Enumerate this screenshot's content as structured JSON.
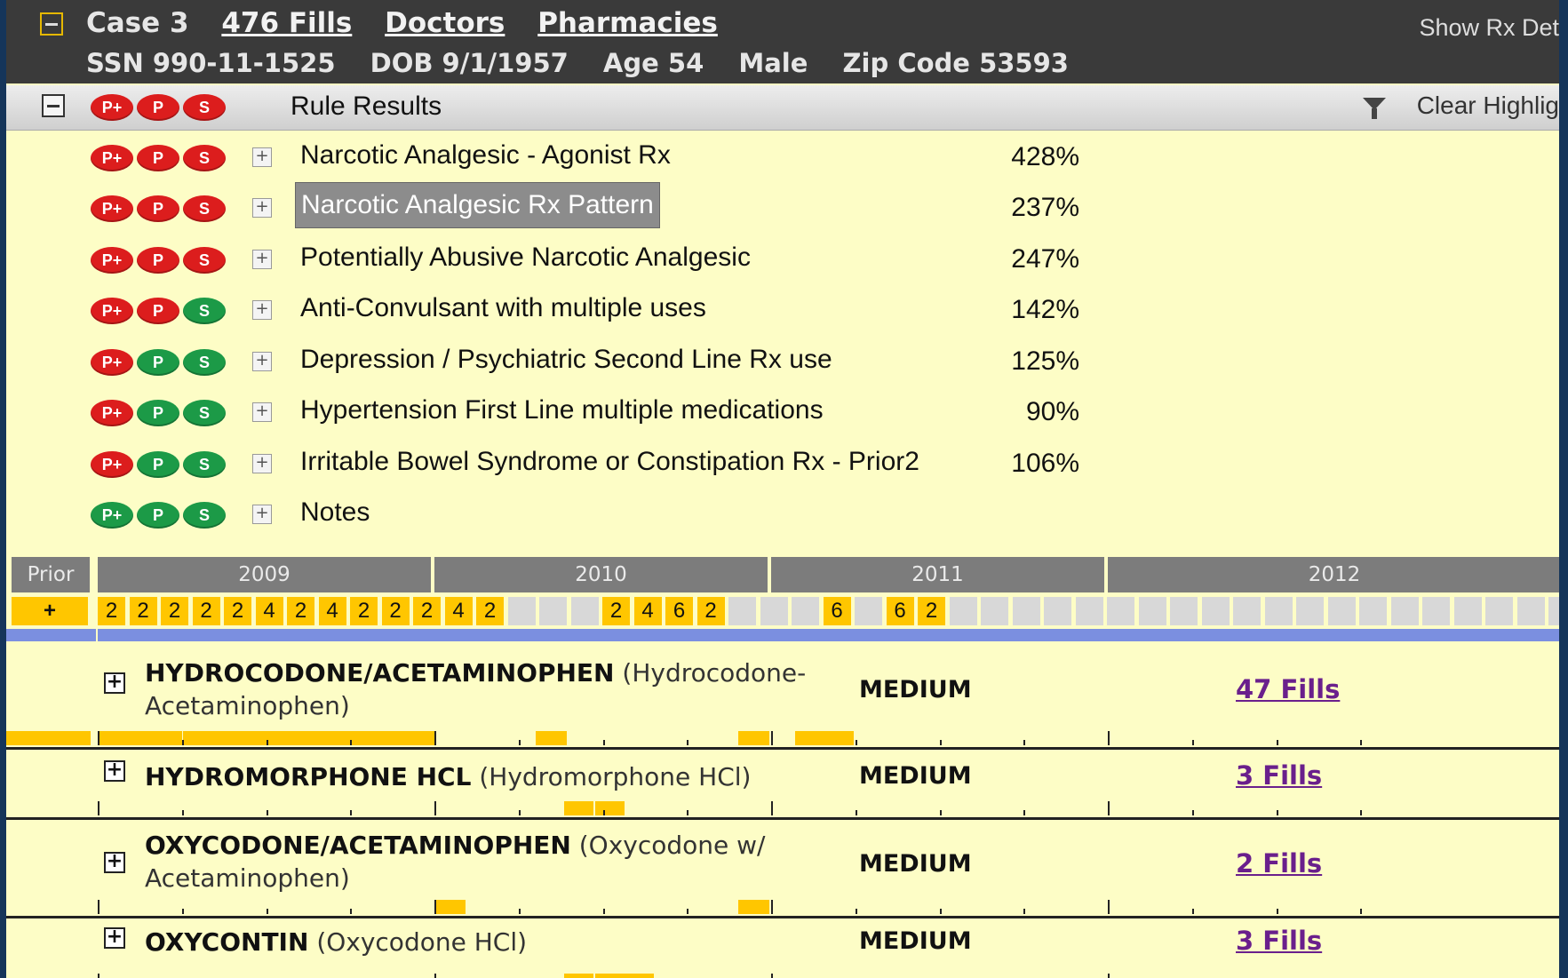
{
  "header": {
    "case": "Case 3",
    "fills_link": "476 Fills",
    "doctors_link": "Doctors",
    "pharmacies_link": "Pharmacies",
    "ssn": "SSN 990-11-1525",
    "dob": "DOB 9/1/1957",
    "age": "Age 54",
    "sex": "Male",
    "zip": "Zip Code 53593",
    "show_rx": "Show Rx Det"
  },
  "rulebar": {
    "title": "Rule Results",
    "clear": "Clear Highlig",
    "pills": [
      {
        "t": "P+",
        "c": "red"
      },
      {
        "t": "P",
        "c": "red"
      },
      {
        "t": "S",
        "c": "red"
      }
    ]
  },
  "rules": [
    {
      "label": "Narcotic Analgesic - Agonist Rx",
      "pct": "428%",
      "pills": [
        "red",
        "red",
        "red"
      ],
      "selected": false
    },
    {
      "label": "Narcotic Analgesic Rx Pattern",
      "pct": "237%",
      "pills": [
        "red",
        "red",
        "red"
      ],
      "selected": true
    },
    {
      "label": "Potentially Abusive Narcotic Analgesic",
      "pct": "247%",
      "pills": [
        "red",
        "red",
        "red"
      ],
      "selected": false
    },
    {
      "label": "Anti-Convulsant with multiple uses",
      "pct": "142%",
      "pills": [
        "red",
        "red",
        "green"
      ],
      "selected": false
    },
    {
      "label": "Depression / Psychiatric Second Line Rx use",
      "pct": "125%",
      "pills": [
        "red",
        "green",
        "green"
      ],
      "selected": false
    },
    {
      "label": "Hypertension First Line multiple medications",
      "pct": "90%",
      "pills": [
        "red",
        "green",
        "green"
      ],
      "selected": false
    },
    {
      "label": "Irritable Bowel Syndrome or Constipation Rx - Prior2",
      "pct": "106%",
      "pills": [
        "red",
        "green",
        "green"
      ],
      "selected": false
    },
    {
      "label": "Notes",
      "pct": "",
      "pills": [
        "green",
        "green",
        "green"
      ],
      "selected": false
    }
  ],
  "pill_letters": [
    "P+",
    "P",
    "S"
  ],
  "timeline": {
    "years": [
      "Prior",
      "2009",
      "2010",
      "2011",
      "2012"
    ],
    "prior_cell": "+",
    "cells": [
      "2",
      "2",
      "2",
      "2",
      "2",
      "4",
      "2",
      "4",
      "2",
      "2",
      "2",
      "4",
      "2",
      "",
      "",
      "",
      "2",
      "4",
      "6",
      "2",
      "",
      "",
      "",
      "6",
      "",
      "6",
      "2",
      "",
      "",
      "",
      "",
      "",
      "",
      "",
      "",
      "",
      "",
      "",
      "",
      "",
      "",
      "",
      "",
      "",
      "",
      "",
      "",
      "",
      "",
      ""
    ]
  },
  "drugs": [
    {
      "name": "HYDROCODONE/ACETAMINOPHEN",
      "generic_line1": "(Hydrocodone-",
      "generic_line2": "Acetaminophen)",
      "level": "MEDIUM",
      "fills": "47 Fills"
    },
    {
      "name": "HYDROMORPHONE HCL",
      "generic_line1": "(Hydromorphone HCl)",
      "generic_line2": "",
      "level": "MEDIUM",
      "fills": "3 Fills"
    },
    {
      "name": "OXYCODONE/ACETAMINOPHEN",
      "generic_line1": "(Oxycodone w/",
      "generic_line2": "Acetaminophen)",
      "level": "MEDIUM",
      "fills": "2 Fills"
    },
    {
      "name": "OXYCONTIN",
      "generic_line1": "(Oxycodone HCl)",
      "generic_line2": "",
      "level": "MEDIUM",
      "fills": "3 Fills"
    }
  ],
  "colors": {
    "accent_fill": "#ffc600",
    "pill_red": "#dc1d1d",
    "pill_green": "#1c9a47",
    "link": "#6a1f8c",
    "panel": "#fdfdc6"
  }
}
